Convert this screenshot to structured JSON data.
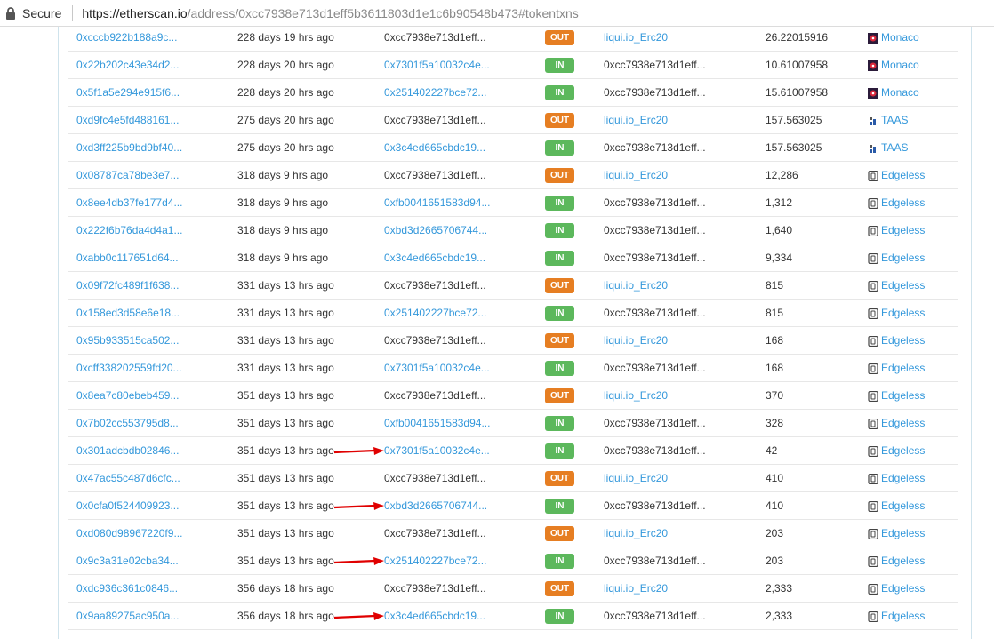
{
  "browser": {
    "secure_label": "Secure",
    "url_main": "https://etherscan.io",
    "url_rest": "/address/0xcc7938e713d1eff5b3611803d1e1c6b90548b473#tokentxns"
  },
  "rows": [
    {
      "tx": "0xcccb922b188a9c...",
      "age": "228 days 19 hrs ago",
      "from": "0xcc7938e713d1eff...",
      "dir": "OUT",
      "to": "liqui.io_Erc20",
      "qty": "26.22015916",
      "token": "Monaco",
      "icon": "monaco"
    },
    {
      "tx": "0x22b202c43e34d2...",
      "age": "228 days 20 hrs ago",
      "from": "0x7301f5a10032c4e...",
      "dir": "IN",
      "to": "0xcc7938e713d1eff...",
      "qty": "10.61007958",
      "token": "Monaco",
      "icon": "monaco"
    },
    {
      "tx": "0x5f1a5e294e915f6...",
      "age": "228 days 20 hrs ago",
      "from": "0x251402227bce72...",
      "dir": "IN",
      "to": "0xcc7938e713d1eff...",
      "qty": "15.61007958",
      "token": "Monaco",
      "icon": "monaco"
    },
    {
      "tx": "0xd9fc4e5fd488161...",
      "age": "275 days 20 hrs ago",
      "from": "0xcc7938e713d1eff...",
      "dir": "OUT",
      "to": "liqui.io_Erc20",
      "qty": "157.563025",
      "token": "TAAS",
      "icon": "taas"
    },
    {
      "tx": "0xd3ff225b9bd9bf40...",
      "age": "275 days 20 hrs ago",
      "from": "0x3c4ed665cbdc19...",
      "dir": "IN",
      "to": "0xcc7938e713d1eff...",
      "qty": "157.563025",
      "token": "TAAS",
      "icon": "taas"
    },
    {
      "tx": "0x08787ca78be3e7...",
      "age": "318 days 9 hrs ago",
      "from": "0xcc7938e713d1eff...",
      "dir": "OUT",
      "to": "liqui.io_Erc20",
      "qty": "12,286",
      "token": "Edgeless",
      "icon": "edgeless"
    },
    {
      "tx": "0x8ee4db37fe177d4...",
      "age": "318 days 9 hrs ago",
      "from": "0xfb0041651583d94...",
      "dir": "IN",
      "to": "0xcc7938e713d1eff...",
      "qty": "1,312",
      "token": "Edgeless",
      "icon": "edgeless"
    },
    {
      "tx": "0x222f6b76da4d4a1...",
      "age": "318 days 9 hrs ago",
      "from": "0xbd3d2665706744...",
      "dir": "IN",
      "to": "0xcc7938e713d1eff...",
      "qty": "1,640",
      "token": "Edgeless",
      "icon": "edgeless"
    },
    {
      "tx": "0xabb0c117651d64...",
      "age": "318 days 9 hrs ago",
      "from": "0x3c4ed665cbdc19...",
      "dir": "IN",
      "to": "0xcc7938e713d1eff...",
      "qty": "9,334",
      "token": "Edgeless",
      "icon": "edgeless"
    },
    {
      "tx": "0x09f72fc489f1f638...",
      "age": "331 days 13 hrs ago",
      "from": "0xcc7938e713d1eff...",
      "dir": "OUT",
      "to": "liqui.io_Erc20",
      "qty": "815",
      "token": "Edgeless",
      "icon": "edgeless"
    },
    {
      "tx": "0x158ed3d58e6e18...",
      "age": "331 days 13 hrs ago",
      "from": "0x251402227bce72...",
      "dir": "IN",
      "to": "0xcc7938e713d1eff...",
      "qty": "815",
      "token": "Edgeless",
      "icon": "edgeless"
    },
    {
      "tx": "0x95b933515ca502...",
      "age": "331 days 13 hrs ago",
      "from": "0xcc7938e713d1eff...",
      "dir": "OUT",
      "to": "liqui.io_Erc20",
      "qty": "168",
      "token": "Edgeless",
      "icon": "edgeless"
    },
    {
      "tx": "0xcff338202559fd20...",
      "age": "331 days 13 hrs ago",
      "from": "0x7301f5a10032c4e...",
      "dir": "IN",
      "to": "0xcc7938e713d1eff...",
      "qty": "168",
      "token": "Edgeless",
      "icon": "edgeless"
    },
    {
      "tx": "0x8ea7c80ebeb459...",
      "age": "351 days 13 hrs ago",
      "from": "0xcc7938e713d1eff...",
      "dir": "OUT",
      "to": "liqui.io_Erc20",
      "qty": "370",
      "token": "Edgeless",
      "icon": "edgeless"
    },
    {
      "tx": "0x7b02cc553795d8...",
      "age": "351 days 13 hrs ago",
      "from": "0xfb0041651583d94...",
      "dir": "IN",
      "to": "0xcc7938e713d1eff...",
      "qty": "328",
      "token": "Edgeless",
      "icon": "edgeless"
    },
    {
      "tx": "0x301adcbdb02846...",
      "age": "351 days 13 hrs ago",
      "from": "0x7301f5a10032c4e...",
      "dir": "IN",
      "to": "0xcc7938e713d1eff...",
      "qty": "42",
      "token": "Edgeless",
      "icon": "edgeless",
      "arrow": true
    },
    {
      "tx": "0x47ac55c487d6cfc...",
      "age": "351 days 13 hrs ago",
      "from": "0xcc7938e713d1eff...",
      "dir": "OUT",
      "to": "liqui.io_Erc20",
      "qty": "410",
      "token": "Edgeless",
      "icon": "edgeless"
    },
    {
      "tx": "0x0cfa0f524409923...",
      "age": "351 days 13 hrs ago",
      "from": "0xbd3d2665706744...",
      "dir": "IN",
      "to": "0xcc7938e713d1eff...",
      "qty": "410",
      "token": "Edgeless",
      "icon": "edgeless",
      "arrow": true
    },
    {
      "tx": "0xd080d98967220f9...",
      "age": "351 days 13 hrs ago",
      "from": "0xcc7938e713d1eff...",
      "dir": "OUT",
      "to": "liqui.io_Erc20",
      "qty": "203",
      "token": "Edgeless",
      "icon": "edgeless"
    },
    {
      "tx": "0x9c3a31e02cba34...",
      "age": "351 days 13 hrs ago",
      "from": "0x251402227bce72...",
      "dir": "IN",
      "to": "0xcc7938e713d1eff...",
      "qty": "203",
      "token": "Edgeless",
      "icon": "edgeless",
      "arrow": true
    },
    {
      "tx": "0xdc936c361c0846...",
      "age": "356 days 18 hrs ago",
      "from": "0xcc7938e713d1eff...",
      "dir": "OUT",
      "to": "liqui.io_Erc20",
      "qty": "2,333",
      "token": "Edgeless",
      "icon": "edgeless"
    },
    {
      "tx": "0x9aa89275ac950a...",
      "age": "356 days 18 hrs ago",
      "from": "0x3c4ed665cbdc19...",
      "dir": "IN",
      "to": "0xcc7938e713d1eff...",
      "qty": "2,333",
      "token": "Edgeless",
      "icon": "edgeless",
      "arrow": true
    }
  ],
  "colors": {
    "link": "#3498db",
    "badge_in": "#5cb85c",
    "badge_out": "#e67e22",
    "annotation_arrow": "#e00000"
  }
}
